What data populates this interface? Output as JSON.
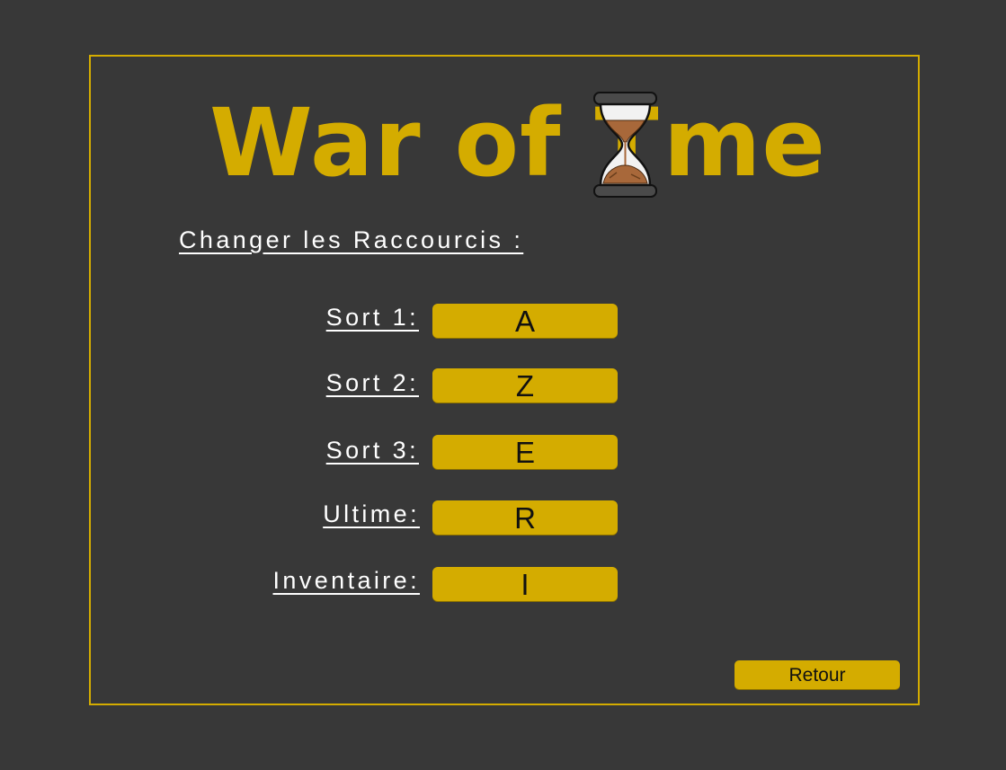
{
  "logo": {
    "text_before": "War of T",
    "text_after": "me",
    "hourglass_icon": "hourglass-icon"
  },
  "title": "Changer les Raccourcis :",
  "shortcuts": [
    {
      "label": "Sort 1:",
      "key": "A"
    },
    {
      "label": "Sort 2:",
      "key": "Z"
    },
    {
      "label": "Sort 3:",
      "key": "E"
    },
    {
      "label": "Ultime:",
      "key": "R"
    },
    {
      "label": "Inventaire:",
      "key": "I"
    }
  ],
  "back_button": "Retour",
  "colors": {
    "background": "#383838",
    "accent": "#d4ac00",
    "text": "#ffffff"
  }
}
